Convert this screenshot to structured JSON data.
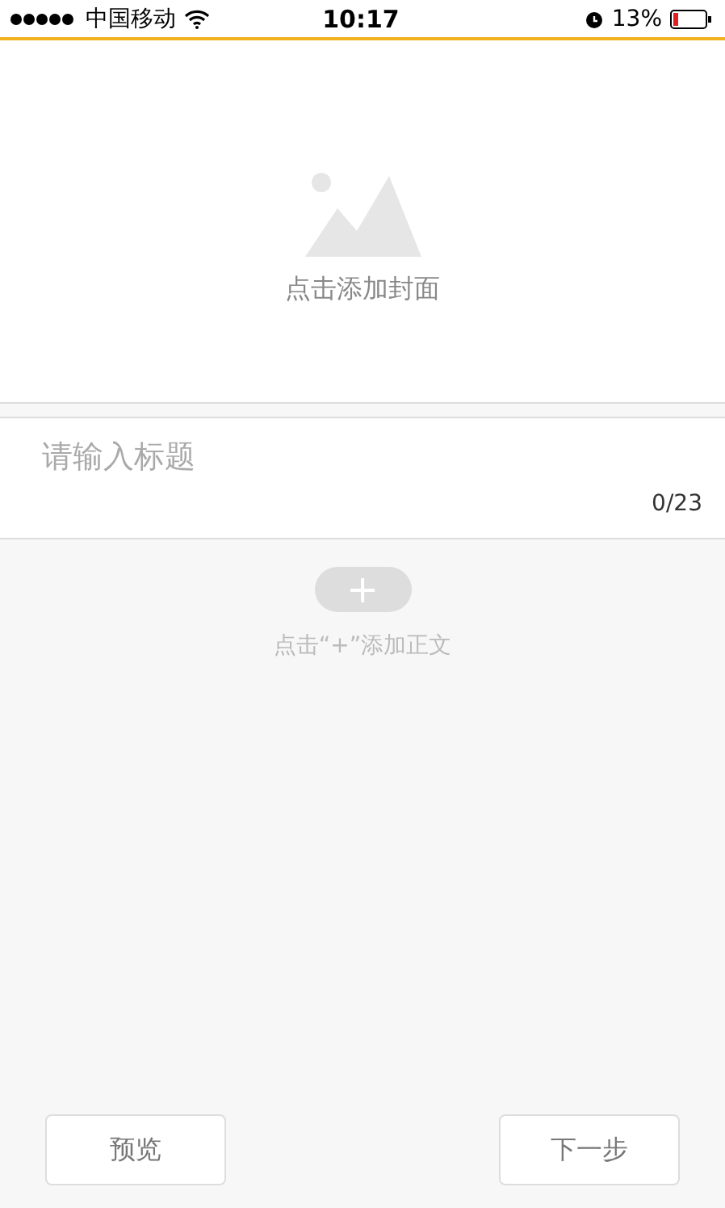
{
  "status_bar": {
    "carrier": "中国移动",
    "time": "10:17",
    "battery": "13%"
  },
  "cover": {
    "label": "点击添加封面"
  },
  "title_field": {
    "placeholder": "请输入标题",
    "counter": "0/23"
  },
  "body": {
    "add_button": "+",
    "hint": "点击“+”添加正文"
  },
  "buttons": [
    "预览",
    "下一步"
  ]
}
